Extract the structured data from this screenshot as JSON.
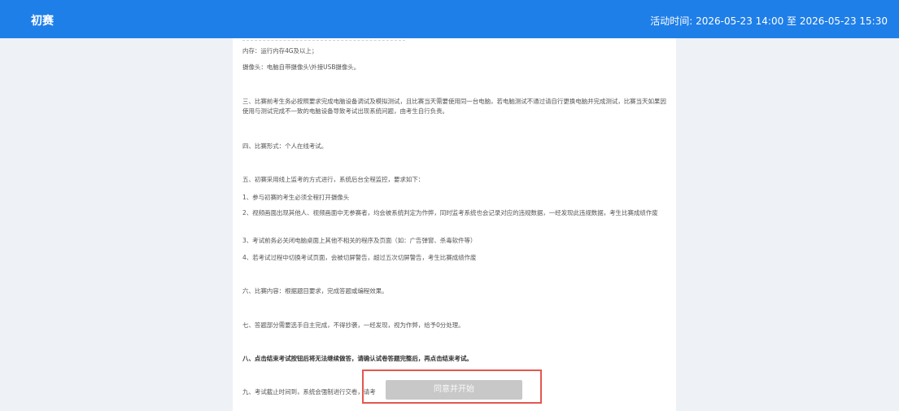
{
  "header": {
    "title": "初赛",
    "activity_time": "活动时间: 2026-05-23 14:00 至 2026-05-23 15:30"
  },
  "rules": [
    "内存：运行内存4G及以上；",
    "摄像头：电脑自带摄像头\\外接USB摄像头。",
    "三、比赛前考生务必按照要求完成电脑设备调试及模拟测试，且比赛当天需要使用同一台电脑，若电脑测试不通过请自行更换电脑并完成测试，比赛当天如果因使用与测试完成不一致的电脑设备导致考试出现系统问题，由考生自行负责。",
    "四、比赛形式：个人在线考试。",
    "五、初赛采用线上监考的方式进行，系统后台全程监控，要求如下：",
    "1、参与初赛的考生必须全程打开摄像头",
    "2、视频画面出现其他人、视频画面中无参赛者，均会被系统判定为作弊，同时监考系统也会记录对应的违规数据，一经发现此违规数据，考生比赛成绩作废",
    "3、考试前务必关闭电脑桌面上其他不相关的程序及页面（如：广告弹窗、杀毒软件等）",
    "4、若考试过程中切换考试页面，会被切屏警告，超过五次切屏警告，考生比赛成绩作废",
    "六、比赛内容：根据题目要求，完成答题或编程效果。",
    "七、答题部分需要选手自主完成，不得抄袭，一经发现，视为作弊，给予0分处理。",
    "八、点击结束考试按钮后将无法继续做答，请确认试卷答题完整后，再点击结束考试。",
    "九、考试截止时间到，系统会强制进行交卷，请考"
  ],
  "button": {
    "agree_start": "同意并开始"
  }
}
